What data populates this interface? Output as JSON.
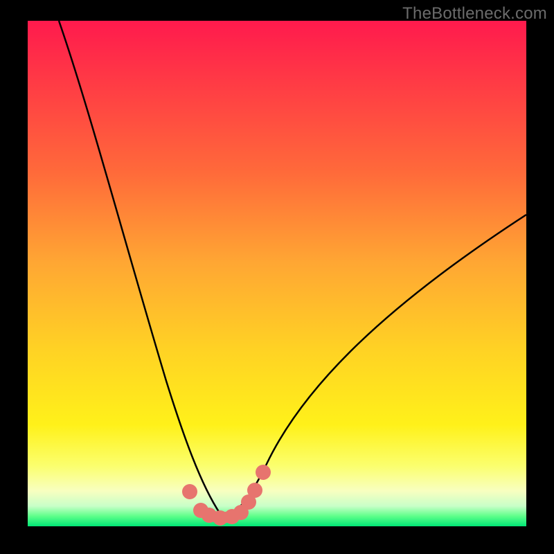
{
  "watermark": "TheBottleneck.com",
  "chart_data": {
    "type": "line",
    "title": "",
    "xlabel": "",
    "ylabel": "",
    "xlim": [
      0,
      100
    ],
    "ylim": [
      0,
      100
    ],
    "grid": false,
    "legend": false,
    "series": [
      {
        "name": "bottleneck-curve",
        "x": [
          6,
          10,
          14,
          18,
          22,
          26,
          30,
          33,
          35,
          37,
          38,
          40,
          42,
          44,
          46,
          50,
          55,
          62,
          72,
          85,
          100
        ],
        "values": [
          100,
          88,
          74,
          60,
          46,
          32,
          19,
          10,
          5,
          2,
          1,
          1,
          2,
          4,
          8,
          15,
          23,
          32,
          42,
          52,
          62
        ]
      }
    ],
    "markers": {
      "name": "highlighted-points",
      "color": "#e7746e",
      "points": [
        {
          "x": 32,
          "y": 12
        },
        {
          "x": 34,
          "y": 6
        },
        {
          "x": 36,
          "y": 2
        },
        {
          "x": 38,
          "y": 1
        },
        {
          "x": 40,
          "y": 1
        },
        {
          "x": 42,
          "y": 2
        },
        {
          "x": 43.5,
          "y": 5
        },
        {
          "x": 45,
          "y": 8
        },
        {
          "x": 47,
          "y": 12
        }
      ]
    },
    "background_gradient": {
      "top": "#ff1a4d",
      "mid": "#ffd224",
      "bottom": "#00e676"
    }
  }
}
